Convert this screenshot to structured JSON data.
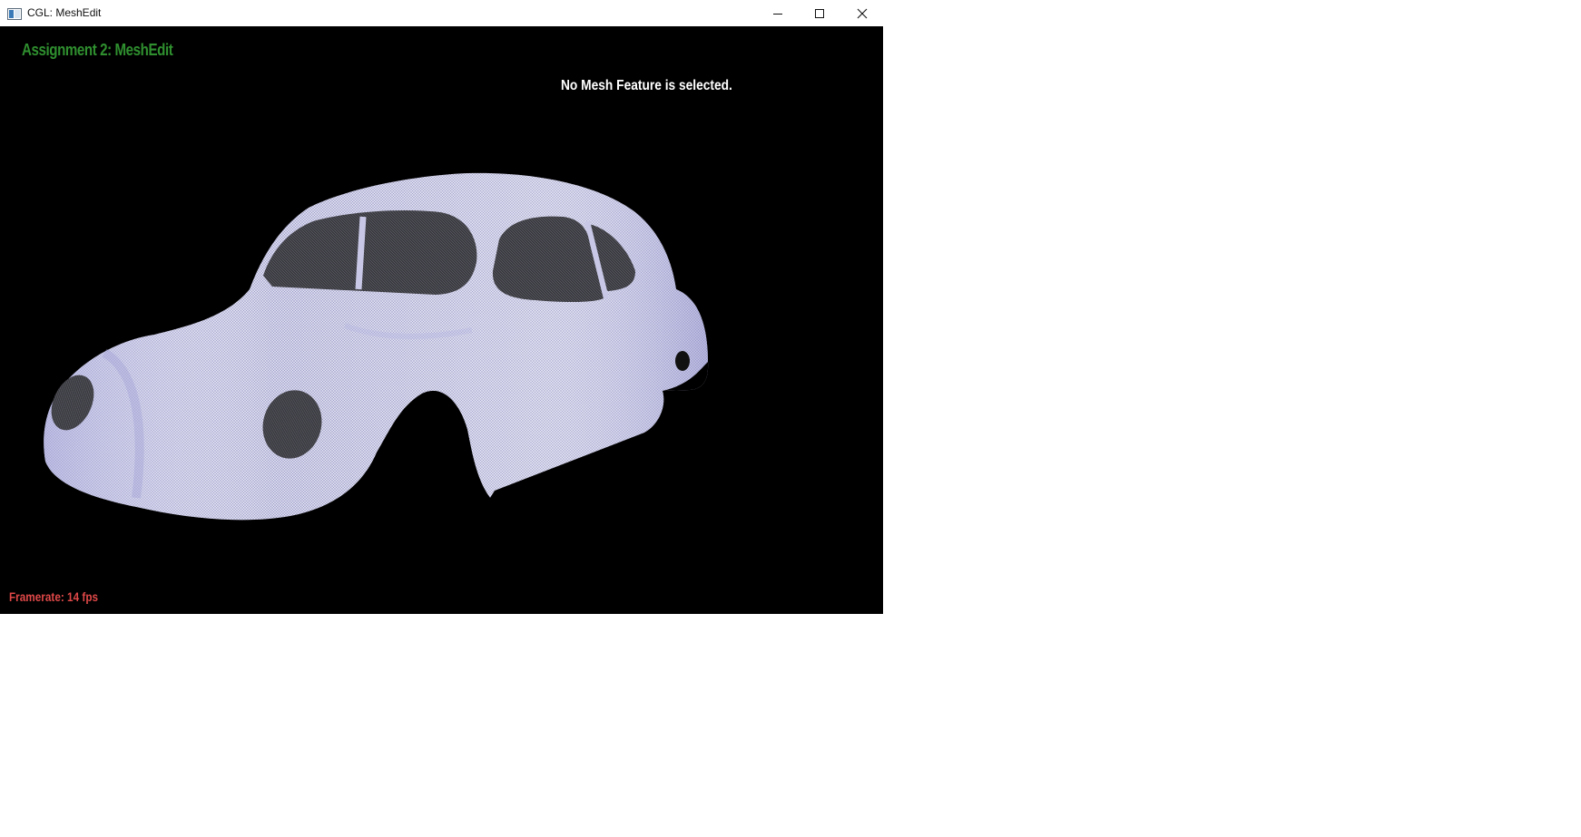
{
  "window": {
    "title": "CGL: MeshEdit",
    "icons": {
      "app": "app-window-icon",
      "minimize": "minimize-icon",
      "maximize": "maximize-icon",
      "close": "close-icon"
    }
  },
  "hud": {
    "title": "Assignment 2: MeshEdit",
    "status": "No Mesh Feature is selected.",
    "framerate": "Framerate: 14 fps"
  },
  "colors": {
    "viewport_bg": "#000000",
    "title_color": "#2f8f2f",
    "framerate_color": "#e04848",
    "mesh_light": "#e6e6f6",
    "mesh_shade": "#a9a9dd"
  }
}
